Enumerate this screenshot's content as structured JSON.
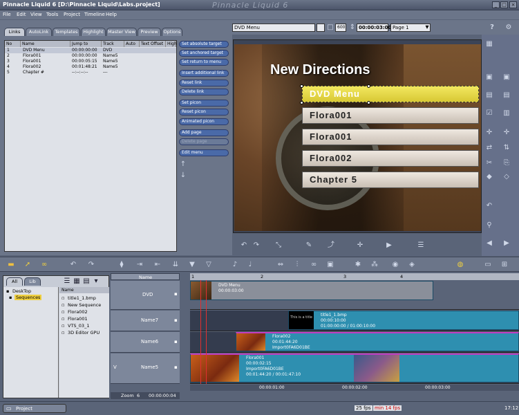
{
  "window": {
    "title": "Pinnacle Liquid 6 [D:\\Pinnacle Liquid\\Labs.project]",
    "brand": "Pinnacle Liquid 6",
    "controls": [
      "_",
      "□",
      "×"
    ]
  },
  "menu": [
    "File",
    "Edit",
    "View",
    "Tools",
    "Project",
    "Timeline",
    "Help"
  ],
  "tabs": [
    {
      "label": "Links",
      "active": true
    },
    {
      "label": "AutoLink",
      "active": false
    },
    {
      "label": "Templates",
      "active": false
    },
    {
      "label": "Highlight",
      "active": false
    },
    {
      "label": "Master View",
      "active": false
    },
    {
      "label": "Preview",
      "active": false
    },
    {
      "label": "Options",
      "active": false
    }
  ],
  "links_table": {
    "columns": [
      "No",
      "Name",
      "Jump to",
      "Track",
      "Auto",
      "Text Offset",
      "High"
    ],
    "rows": [
      {
        "no": "1",
        "name": "DVD Menu",
        "jump": "00:00:00:00",
        "track": "DVD",
        "auto": "",
        "offset": "",
        "selected": true
      },
      {
        "no": "2",
        "name": "Flora001",
        "jump": "00:00:00:00",
        "track": "Name5",
        "auto": "",
        "offset": "",
        "selected": false
      },
      {
        "no": "3",
        "name": "Flora001",
        "jump": "00:00:05:15",
        "track": "Name5",
        "auto": "",
        "offset": "",
        "selected": false
      },
      {
        "no": "4",
        "name": "Flora002",
        "jump": "00:01:48:21",
        "track": "Name5",
        "auto": "",
        "offset": "",
        "selected": false
      },
      {
        "no": "5",
        "name": "Chapter #",
        "jump": "--:--:--:--",
        "track": "---",
        "auto": "",
        "offset": "",
        "selected": false
      }
    ]
  },
  "side_buttons": [
    {
      "label": "Set absolute target",
      "enabled": true
    },
    {
      "label": "Set anchored target",
      "enabled": true
    },
    {
      "label": "Set return to menu",
      "enabled": true
    },
    {
      "label": "Insert additional link",
      "enabled": true
    },
    {
      "label": "Reset link",
      "enabled": true
    },
    {
      "label": "Delete link",
      "enabled": true
    },
    {
      "label": "Set picon",
      "enabled": true
    },
    {
      "label": "Reset picon",
      "enabled": true
    },
    {
      "label": "Animated picon",
      "enabled": true
    },
    {
      "label": "Add page",
      "enabled": true
    },
    {
      "label": "Delete page",
      "enabled": false
    },
    {
      "label": "Edit menu",
      "enabled": true
    }
  ],
  "preview_toolbar": {
    "menu_name": "DVD Menu",
    "value_box": "600",
    "timecode": "00:00:03:00",
    "page": "Page 1"
  },
  "preview": {
    "title": "New Directions",
    "buttons": [
      {
        "label": "DVD Menu",
        "active": true
      },
      {
        "label": "Flora001",
        "active": false
      },
      {
        "label": "Flora001",
        "active": false
      },
      {
        "label": "Flora002",
        "active": false
      },
      {
        "label": "Chapter 5",
        "active": false
      }
    ]
  },
  "bin": {
    "tabs": [
      "All",
      "Lib"
    ],
    "tree": [
      {
        "label": "DeskTop"
      },
      {
        "label": "Sequences"
      }
    ],
    "column": "Name",
    "items": [
      "title1_1.bmp",
      "New Sequence",
      "Flora002",
      "Flora001",
      "VTS_03_1",
      "3D Editor GPU"
    ]
  },
  "timeline": {
    "header": "Name",
    "ruler": [
      "1",
      "2",
      "3",
      "4"
    ],
    "bottom_ruler": [
      "00:00:01:00",
      "00:00:02:00",
      "00:00:03:00"
    ],
    "zoom_label": "Zoom",
    "zoom_value": "6",
    "zoom_tc": "00:00:00:04",
    "tracks": [
      {
        "name": "DVD",
        "clip": {
          "title": "DVD Menu",
          "tc": "00:00:03:00"
        }
      },
      {
        "name": "Name7",
        "clip": {
          "title": "title1_1.bmp",
          "tc": "00:00:10:00",
          "tc2": "01:00:00:00 / 01:00:10:00",
          "thumb": "This is a title"
        }
      },
      {
        "name": "Name6",
        "clip": {
          "title": "Flora002",
          "tc": "00:01:44:20",
          "tc2": "Import0FA6D01BE"
        }
      },
      {
        "name": "Name5",
        "clip": {
          "title": "Flora001",
          "tc": "00:00:02:15",
          "tc2": "Import0FA6D01BE",
          "tc3": "00:01:44:20 / 00:01:47:10"
        }
      }
    ],
    "v_label": "V"
  },
  "status": {
    "project": "Project",
    "fps1": "25 fps",
    "fps2": "min 14 fps",
    "clock": "17:12"
  }
}
